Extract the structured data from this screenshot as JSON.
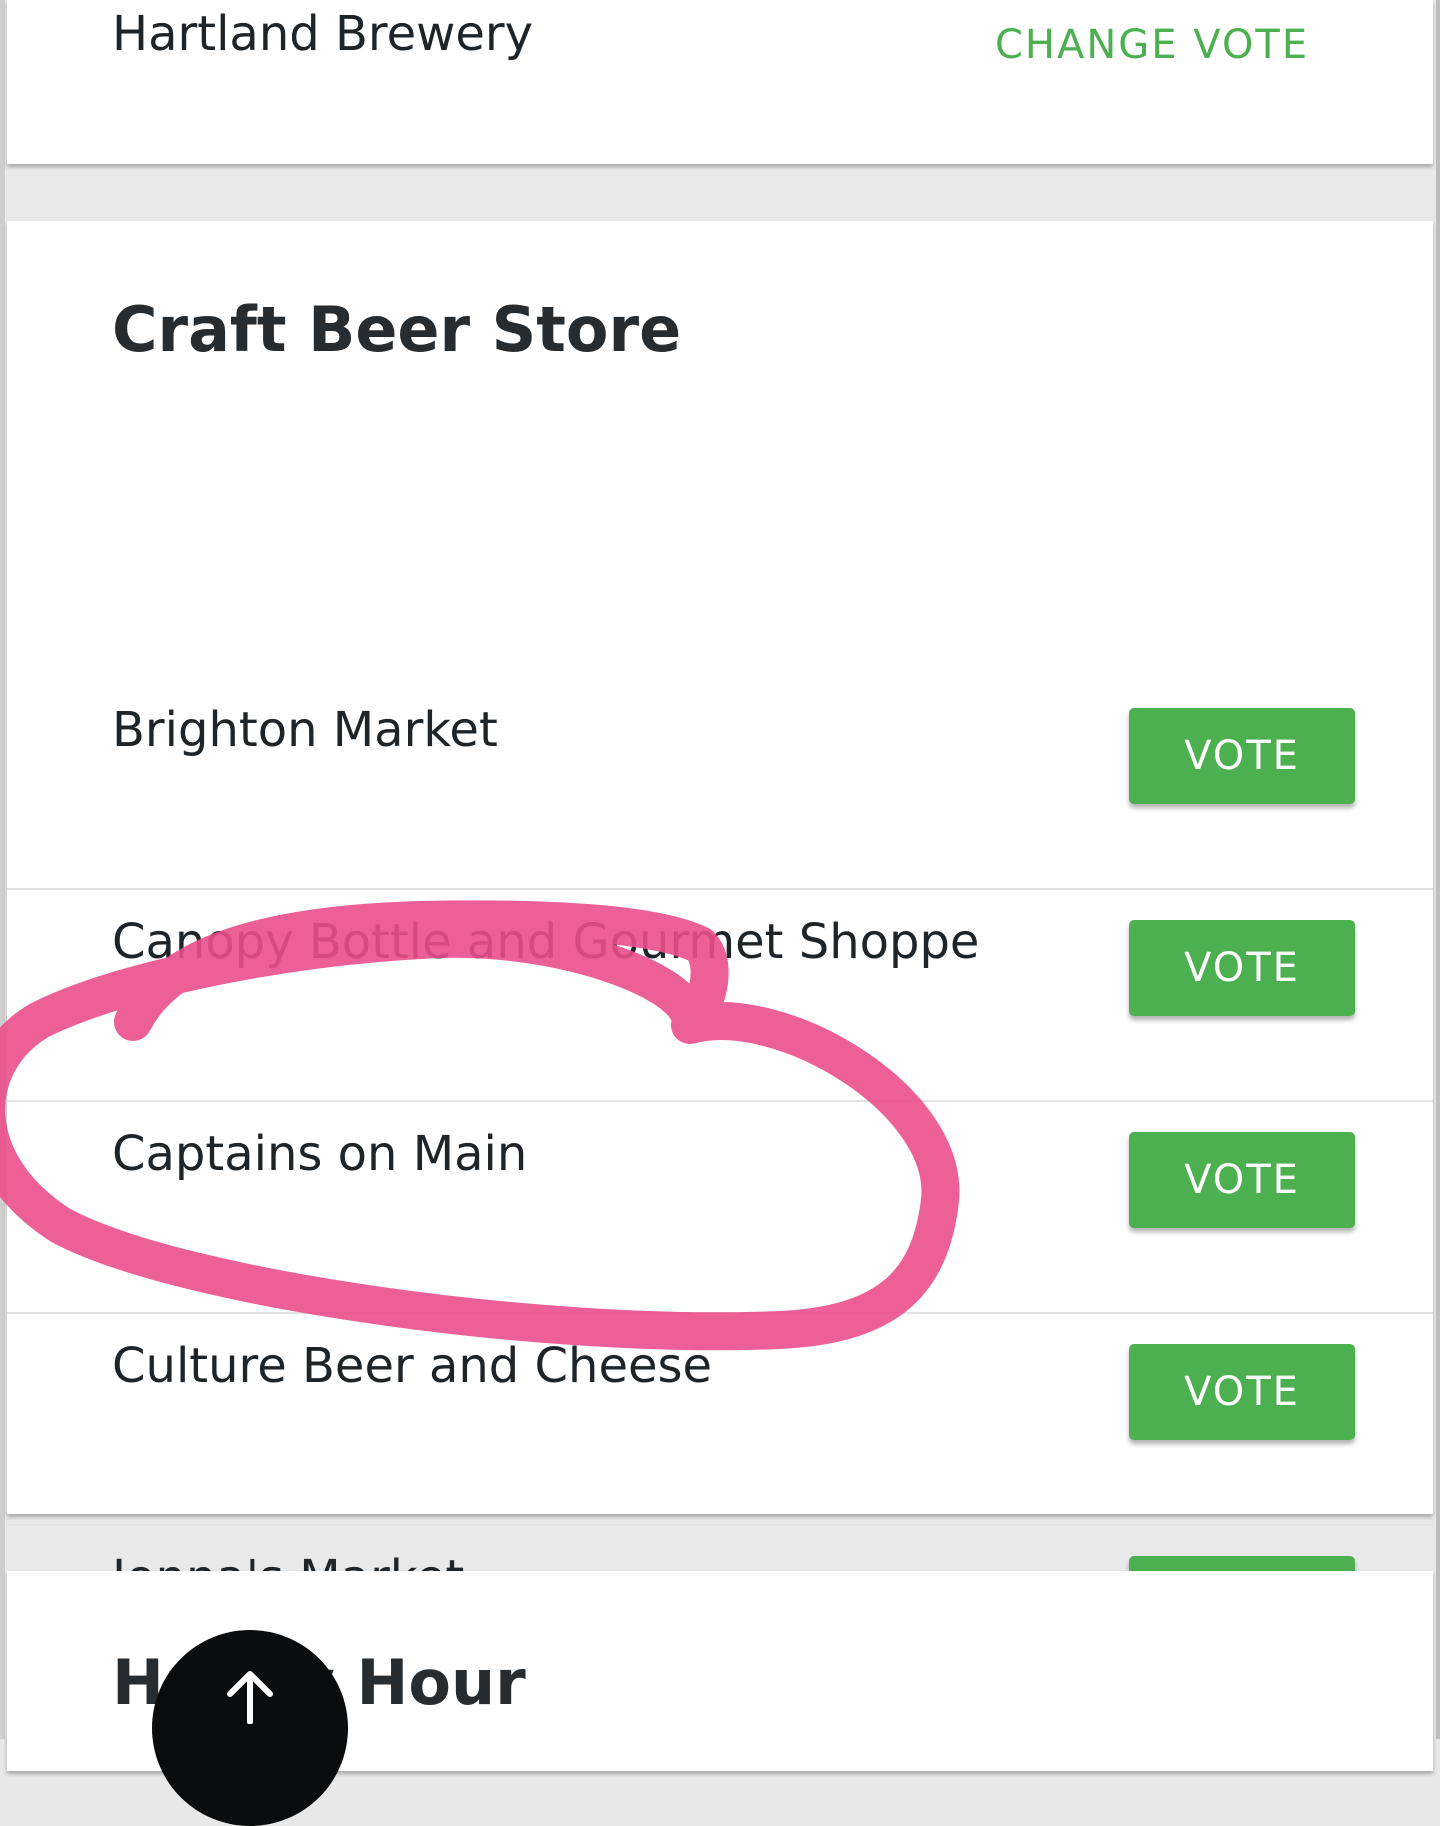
{
  "top_card": {
    "selected_option": "Hartland Brewery",
    "change_vote_label": "CHANGE VOTE"
  },
  "craft_beer_store": {
    "title": "Craft Beer Store",
    "vote_label": "VOTE",
    "options": [
      {
        "name": "Brighton Market"
      },
      {
        "name": "Canopy Bottle and Gourmet Shoppe"
      },
      {
        "name": "Captains on Main"
      },
      {
        "name": "Culture Beer and Cheese"
      },
      {
        "name": "Jonna's Market"
      }
    ]
  },
  "next_section": {
    "title": "Happy Hour"
  },
  "icons": {
    "scroll_top": "arrow-up-icon"
  },
  "colors": {
    "accent_green": "#4caf50",
    "annotation_pink": "#ea4f8c",
    "text": "#1f2428"
  }
}
